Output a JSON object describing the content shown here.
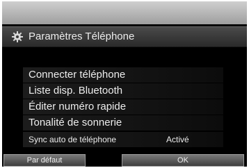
{
  "header": {
    "icon": "gear-icon",
    "title": "Paramètres Téléphone"
  },
  "menu": {
    "items": [
      {
        "label": "Connecter téléphone"
      },
      {
        "label": "Liste disp. Bluetooth"
      },
      {
        "label": "Éditer numéro rapide"
      },
      {
        "label": "Tonalité de sonnerie"
      },
      {
        "label": "Sync auto de téléphone",
        "value": "Activé"
      }
    ]
  },
  "footer": {
    "default_label": "Par défaut",
    "ok_label": "OK"
  }
}
